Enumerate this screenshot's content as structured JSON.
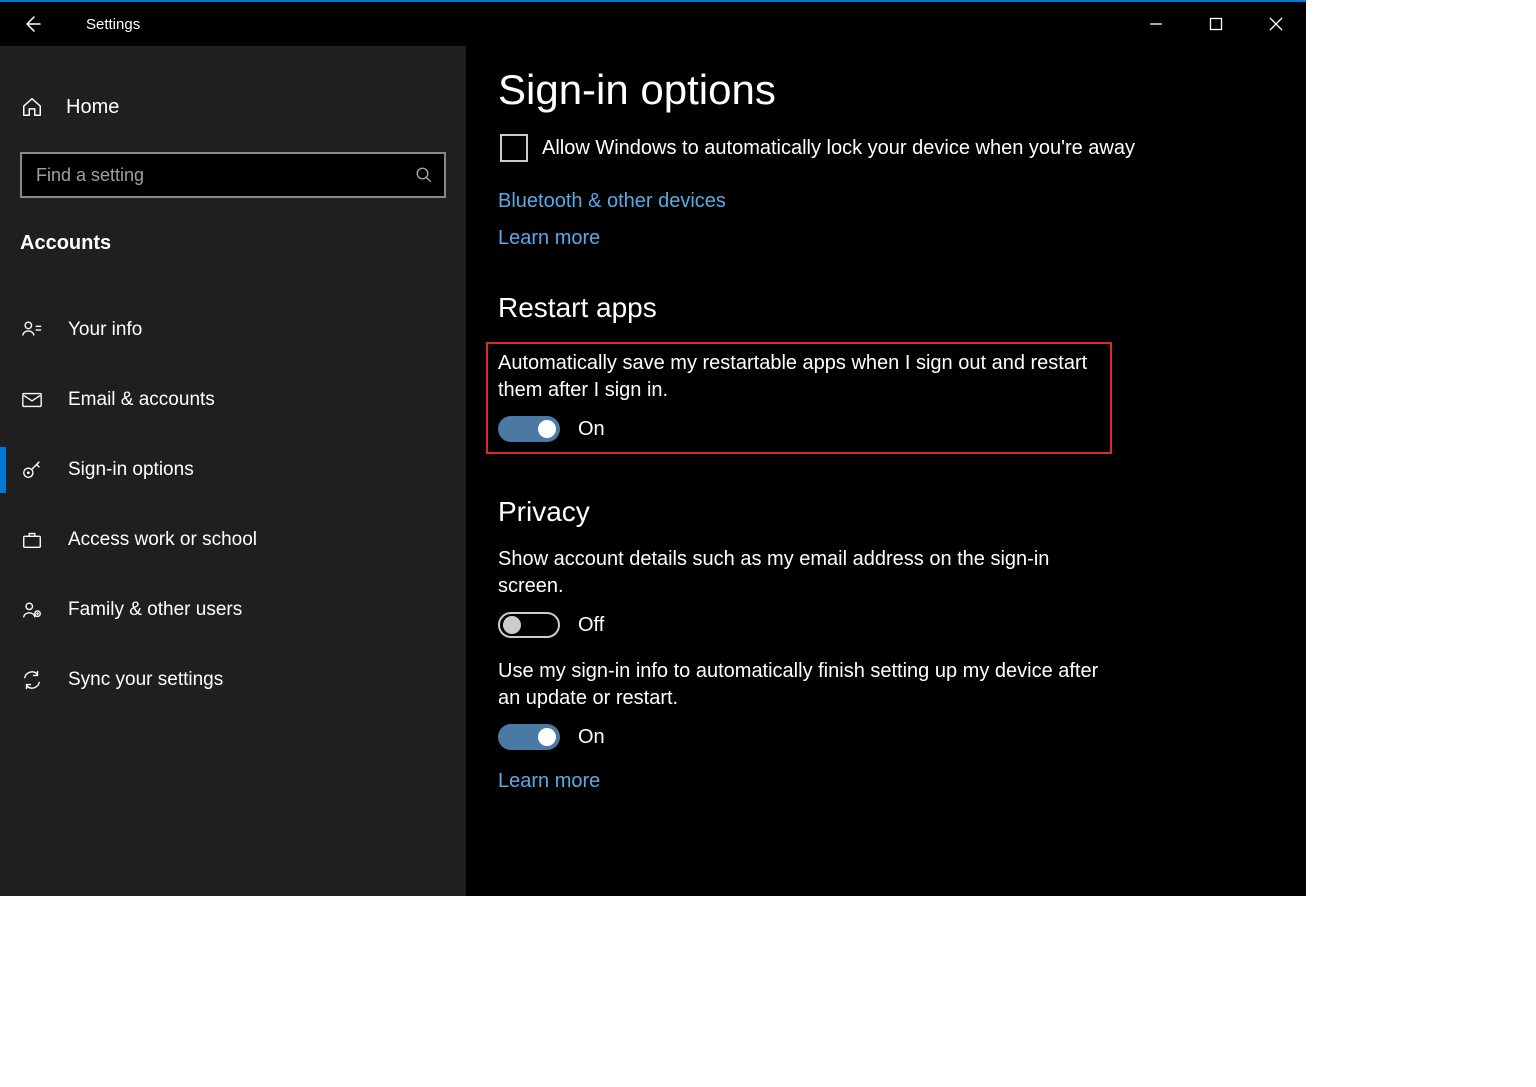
{
  "window": {
    "title": "Settings"
  },
  "sidebar": {
    "home": "Home",
    "search_placeholder": "Find a setting",
    "section": "Accounts",
    "items": [
      {
        "label": "Your info"
      },
      {
        "label": "Email & accounts"
      },
      {
        "label": "Sign-in options",
        "selected": true
      },
      {
        "label": "Access work or school"
      },
      {
        "label": "Family & other users"
      },
      {
        "label": "Sync your settings"
      }
    ]
  },
  "main": {
    "title": "Sign-in options",
    "lock_checkbox": {
      "label": "Allow Windows to automatically lock your device when you're away",
      "checked": false
    },
    "links": {
      "bluetooth": "Bluetooth & other devices",
      "learn_more_1": "Learn more",
      "learn_more_2": "Learn more"
    },
    "restart_apps": {
      "heading": "Restart apps",
      "desc": "Automatically save my restartable apps when I sign out and restart them after I sign in.",
      "toggle_state": "On"
    },
    "privacy": {
      "heading": "Privacy",
      "show_details": {
        "desc": "Show account details such as my email address on the sign-in screen.",
        "toggle_state": "Off"
      },
      "finish_setup": {
        "desc": "Use my sign-in info to automatically finish setting up my device after an update or restart.",
        "toggle_state": "On"
      }
    }
  }
}
